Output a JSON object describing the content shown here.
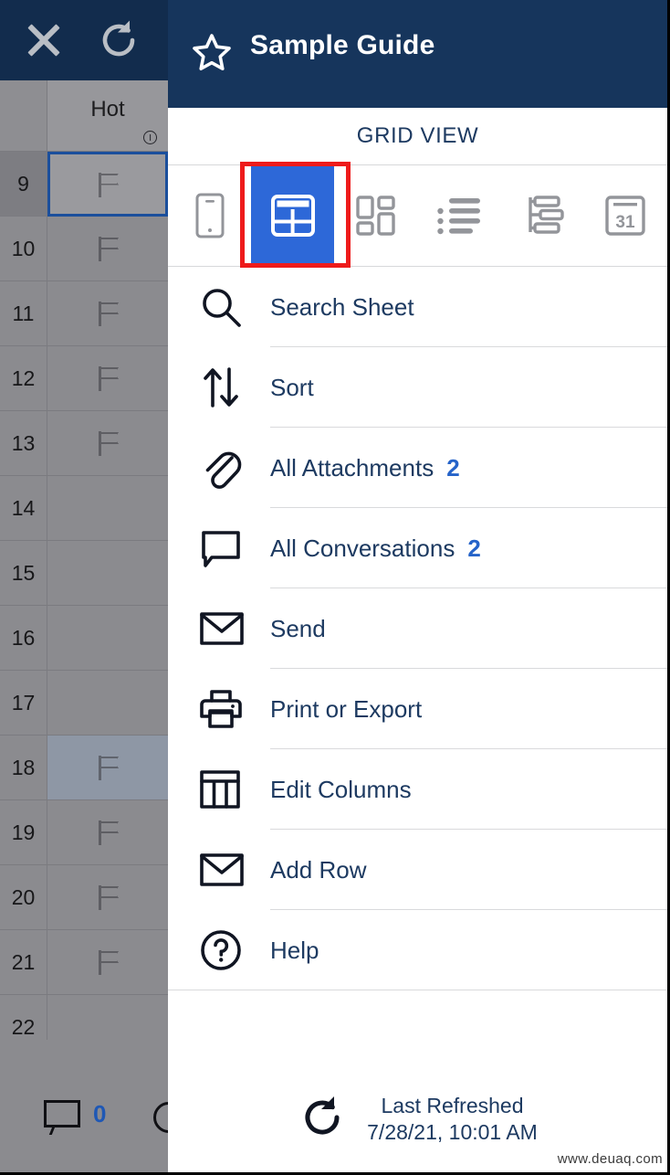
{
  "left_pane": {
    "close_icon": "close-x-icon",
    "refresh_icon": "refresh-icon",
    "column_header": {
      "label": "Hot",
      "info_icon": "info-circle-icon"
    },
    "rows": [
      {
        "number": "9",
        "flag": true,
        "selected": true,
        "highlighted": false
      },
      {
        "number": "10",
        "flag": true,
        "selected": false,
        "highlighted": false
      },
      {
        "number": "11",
        "flag": true,
        "selected": false,
        "highlighted": false
      },
      {
        "number": "12",
        "flag": true,
        "selected": false,
        "highlighted": false
      },
      {
        "number": "13",
        "flag": true,
        "selected": false,
        "highlighted": false
      },
      {
        "number": "14",
        "flag": false,
        "selected": false,
        "highlighted": false
      },
      {
        "number": "15",
        "flag": false,
        "selected": false,
        "highlighted": false
      },
      {
        "number": "16",
        "flag": false,
        "selected": false,
        "highlighted": false
      },
      {
        "number": "17",
        "flag": false,
        "selected": false,
        "highlighted": false
      },
      {
        "number": "18",
        "flag": true,
        "selected": false,
        "highlighted": true
      },
      {
        "number": "19",
        "flag": true,
        "selected": false,
        "highlighted": false
      },
      {
        "number": "20",
        "flag": true,
        "selected": false,
        "highlighted": false
      },
      {
        "number": "21",
        "flag": true,
        "selected": false,
        "highlighted": false
      },
      {
        "number": "22",
        "flag": false,
        "selected": false,
        "highlighted": false
      }
    ],
    "bottom_bar": {
      "comment_icon": "comment-bubble-icon",
      "comment_count": "0"
    }
  },
  "panel": {
    "header": {
      "star_icon": "star-outline-icon",
      "title": "Sample Guide",
      "background_color": "#16355c"
    },
    "view_label": "GRID VIEW",
    "view_tabs": [
      {
        "name": "card-view",
        "icon": "mobile-card-icon",
        "active": false
      },
      {
        "name": "grid-view",
        "icon": "grid-table-icon",
        "active": true
      },
      {
        "name": "gallery-view",
        "icon": "gallery-tile-icon",
        "active": false
      },
      {
        "name": "list-view",
        "icon": "bullet-list-icon",
        "active": false
      },
      {
        "name": "gantt-view",
        "icon": "gantt-chart-icon",
        "active": false
      },
      {
        "name": "calendar-view",
        "icon": "calendar-icon",
        "active": false,
        "glyph": "31"
      }
    ],
    "highlight_color": "#ee1b1b",
    "accent_color": "#2d68d8",
    "menu": [
      {
        "label": "Search Sheet",
        "icon": "magnifier-icon",
        "count": ""
      },
      {
        "label": "Sort",
        "icon": "sort-arrows-icon",
        "count": ""
      },
      {
        "label": "All Attachments",
        "icon": "paperclip-icon",
        "count": "2"
      },
      {
        "label": "All Conversations",
        "icon": "comment-bubble-icon",
        "count": "2"
      },
      {
        "label": "Send",
        "icon": "envelope-icon",
        "count": ""
      },
      {
        "label": "Print or Export",
        "icon": "printer-icon",
        "count": ""
      },
      {
        "label": "Edit Columns",
        "icon": "columns-icon",
        "count": ""
      },
      {
        "label": "Add Row",
        "icon": "envelope-icon",
        "count": ""
      },
      {
        "label": "Help",
        "icon": "question-mark-icon",
        "count": ""
      }
    ],
    "footer": {
      "refresh_icon": "refresh-icon",
      "line1": "Last Refreshed",
      "line2": "7/28/21, 10:01 AM"
    }
  },
  "watermark": "www.deuaq.com"
}
